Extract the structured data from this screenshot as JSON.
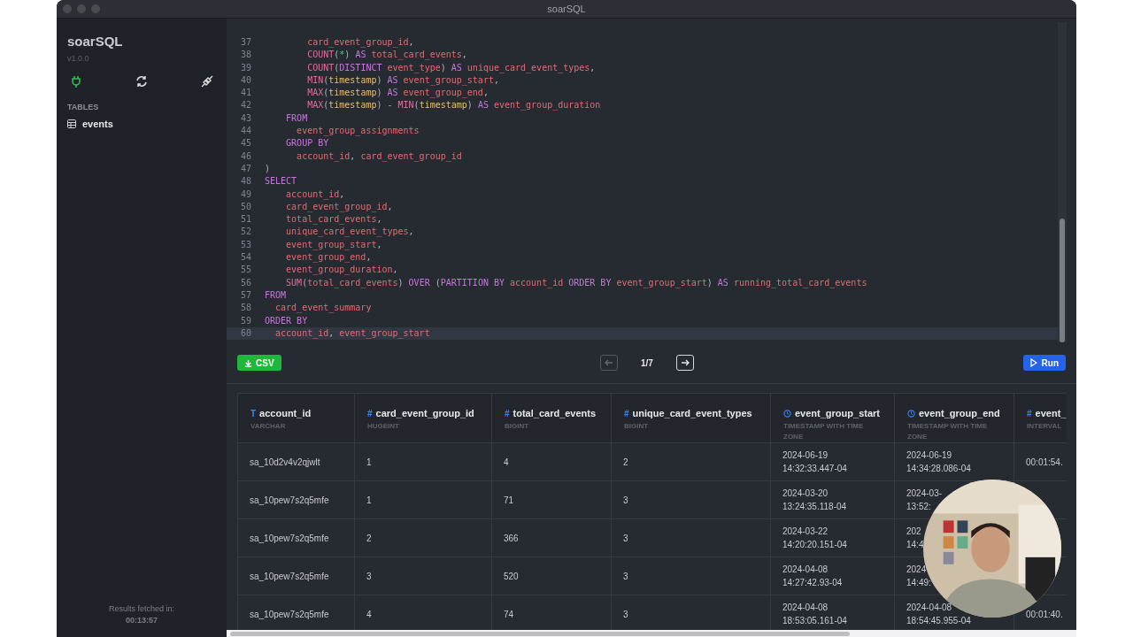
{
  "window": {
    "title": "soarSQL"
  },
  "sidebar": {
    "app_name": "soarSQL",
    "version": "v1.0.0",
    "connected": true,
    "section_label": "TABLES",
    "tables": [
      {
        "name": "events",
        "selected": false
      }
    ],
    "footer_label": "Results fetched in:",
    "footer_time": "00:13:57"
  },
  "editor": {
    "lines": [
      {
        "n": "37",
        "current": false,
        "tokens": [
          {
            "text": "        card_event_group_id",
            "kind": "id"
          },
          {
            "text": ",",
            "kind": "p"
          }
        ]
      },
      {
        "n": "38",
        "current": false,
        "tokens": [
          {
            "text": "        COUNT",
            "kind": "fn"
          },
          {
            "text": "(",
            "kind": "p"
          },
          {
            "text": "*",
            "kind": "op"
          },
          {
            "text": ")",
            "kind": "p"
          },
          {
            "text": " AS ",
            "kind": "kw"
          },
          {
            "text": "total_card_events",
            "kind": "id"
          },
          {
            "text": ",",
            "kind": "p"
          }
        ]
      },
      {
        "n": "39",
        "current": false,
        "tokens": [
          {
            "text": "        COUNT",
            "kind": "fn"
          },
          {
            "text": "(",
            "kind": "p"
          },
          {
            "text": "DISTINCT",
            "kind": "kw"
          },
          {
            "text": " event_type",
            "kind": "id"
          },
          {
            "text": ")",
            "kind": "p"
          },
          {
            "text": " AS ",
            "kind": "kw"
          },
          {
            "text": "unique_card_event_types",
            "kind": "id"
          },
          {
            "text": ",",
            "kind": "p"
          }
        ]
      },
      {
        "n": "40",
        "current": false,
        "tokens": [
          {
            "text": "        MIN",
            "kind": "fn"
          },
          {
            "text": "(",
            "kind": "p"
          },
          {
            "text": "timestamp",
            "kind": "arg"
          },
          {
            "text": ")",
            "kind": "p"
          },
          {
            "text": " AS ",
            "kind": "kw"
          },
          {
            "text": "event_group_start",
            "kind": "id"
          },
          {
            "text": ",",
            "kind": "p"
          }
        ]
      },
      {
        "n": "41",
        "current": false,
        "tokens": [
          {
            "text": "        MAX",
            "kind": "fn"
          },
          {
            "text": "(",
            "kind": "p"
          },
          {
            "text": "timestamp",
            "kind": "arg"
          },
          {
            "text": ")",
            "kind": "p"
          },
          {
            "text": " AS ",
            "kind": "kw"
          },
          {
            "text": "event_group_end",
            "kind": "id"
          },
          {
            "text": ",",
            "kind": "p"
          }
        ]
      },
      {
        "n": "42",
        "current": false,
        "tokens": [
          {
            "text": "        MAX",
            "kind": "fn"
          },
          {
            "text": "(",
            "kind": "p"
          },
          {
            "text": "timestamp",
            "kind": "arg"
          },
          {
            "text": ")",
            "kind": "p"
          },
          {
            "text": " - ",
            "kind": "p"
          },
          {
            "text": "MIN",
            "kind": "fn"
          },
          {
            "text": "(",
            "kind": "p"
          },
          {
            "text": "timestamp",
            "kind": "arg"
          },
          {
            "text": ")",
            "kind": "p"
          },
          {
            "text": " AS ",
            "kind": "kw"
          },
          {
            "text": "event_group_duration",
            "kind": "id"
          }
        ]
      },
      {
        "n": "43",
        "current": false,
        "tokens": [
          {
            "text": "    FROM",
            "kind": "kw"
          }
        ]
      },
      {
        "n": "44",
        "current": false,
        "tokens": [
          {
            "text": "      event_group_assignments",
            "kind": "id"
          }
        ]
      },
      {
        "n": "45",
        "current": false,
        "tokens": [
          {
            "text": "    GROUP BY",
            "kind": "kw"
          }
        ]
      },
      {
        "n": "46",
        "current": false,
        "tokens": [
          {
            "text": "      account_id",
            "kind": "id"
          },
          {
            "text": ", ",
            "kind": "p"
          },
          {
            "text": "card_event_group_id",
            "kind": "id"
          }
        ]
      },
      {
        "n": "47",
        "current": false,
        "tokens": [
          {
            "text": ")",
            "kind": "p"
          }
        ]
      },
      {
        "n": "48",
        "current": false,
        "tokens": [
          {
            "text": "SELECT",
            "kind": "kw"
          }
        ]
      },
      {
        "n": "49",
        "current": false,
        "tokens": [
          {
            "text": "    account_id",
            "kind": "id"
          },
          {
            "text": ",",
            "kind": "p"
          }
        ]
      },
      {
        "n": "50",
        "current": false,
        "tokens": [
          {
            "text": "    card_event_group_id",
            "kind": "id"
          },
          {
            "text": ",",
            "kind": "p"
          }
        ]
      },
      {
        "n": "51",
        "current": false,
        "tokens": [
          {
            "text": "    total_card_events",
            "kind": "id"
          },
          {
            "text": ",",
            "kind": "p"
          }
        ]
      },
      {
        "n": "52",
        "current": false,
        "tokens": [
          {
            "text": "    unique_card_event_types",
            "kind": "id"
          },
          {
            "text": ",",
            "kind": "p"
          }
        ]
      },
      {
        "n": "53",
        "current": false,
        "tokens": [
          {
            "text": "    event_group_start",
            "kind": "id"
          },
          {
            "text": ",",
            "kind": "p"
          }
        ]
      },
      {
        "n": "54",
        "current": false,
        "tokens": [
          {
            "text": "    event_group_end",
            "kind": "id"
          },
          {
            "text": ",",
            "kind": "p"
          }
        ]
      },
      {
        "n": "55",
        "current": false,
        "tokens": [
          {
            "text": "    event_group_duration",
            "kind": "id"
          },
          {
            "text": ",",
            "kind": "p"
          }
        ]
      },
      {
        "n": "56",
        "current": false,
        "tokens": [
          {
            "text": "    SUM",
            "kind": "fn"
          },
          {
            "text": "(",
            "kind": "p"
          },
          {
            "text": "total_card_events",
            "kind": "id"
          },
          {
            "text": ")",
            "kind": "p"
          },
          {
            "text": " OVER ",
            "kind": "kw"
          },
          {
            "text": "(",
            "kind": "p"
          },
          {
            "text": "PARTITION BY",
            "kind": "kw"
          },
          {
            "text": " account_id ",
            "kind": "id"
          },
          {
            "text": "ORDER BY",
            "kind": "kw"
          },
          {
            "text": " event_group_start",
            "kind": "id"
          },
          {
            "text": ")",
            "kind": "p"
          },
          {
            "text": " AS ",
            "kind": "kw"
          },
          {
            "text": "running_total_card_events",
            "kind": "id"
          }
        ]
      },
      {
        "n": "57",
        "current": false,
        "tokens": [
          {
            "text": "FROM",
            "kind": "kw"
          }
        ]
      },
      {
        "n": "58",
        "current": false,
        "tokens": [
          {
            "text": "  card_event_summary",
            "kind": "id"
          }
        ]
      },
      {
        "n": "59",
        "current": false,
        "tokens": [
          {
            "text": "ORDER BY",
            "kind": "kw"
          }
        ]
      },
      {
        "n": "60",
        "current": true,
        "tokens": [
          {
            "text": "  account_id",
            "kind": "id"
          },
          {
            "text": ", ",
            "kind": "p"
          },
          {
            "text": "event_group_start",
            "kind": "id"
          }
        ]
      }
    ]
  },
  "toolbar": {
    "export_label": "CSV",
    "page": "1/7",
    "prev_disabled": true,
    "next_disabled": false,
    "run_label": "Run"
  },
  "results": {
    "columns": [
      {
        "kind": "text",
        "glyph": "T",
        "name": "account_id",
        "type": "VARCHAR"
      },
      {
        "kind": "number",
        "glyph": "#",
        "name": "card_event_group_id",
        "type": "HUGEINT"
      },
      {
        "kind": "number",
        "glyph": "#",
        "name": "total_card_events",
        "type": "BIGINT"
      },
      {
        "kind": "number",
        "glyph": "#",
        "name": "unique_card_event_types",
        "type": "BIGINT"
      },
      {
        "kind": "time",
        "name": "event_group_start",
        "type": "TIMESTAMP WITH TIME ZONE"
      },
      {
        "kind": "time",
        "name": "event_group_end",
        "type": "TIMESTAMP WITH TIME ZONE"
      },
      {
        "kind": "number",
        "glyph": "#",
        "name": "event_",
        "type": "INTERVAL"
      }
    ],
    "rows": [
      {
        "cells": [
          "sa_10d2v4v2qjwlt",
          "1",
          "4",
          "2",
          "2024-06-19\n14:32:33.447-04",
          "2024-06-19\n14:34:28.086-04",
          "00:01:54."
        ]
      },
      {
        "cells": [
          "sa_10pew7s2q5mfe",
          "1",
          "71",
          "3",
          "2024-03-20\n13:24:35.118-04",
          "2024-03-\n13:52:"
        ]
      },
      {
        "cells": [
          "sa_10pew7s2q5mfe",
          "2",
          "366",
          "3",
          "2024-03-22\n14:20:20.151-04",
          "202\n14:4"
        ]
      },
      {
        "cells": [
          "sa_10pew7s2q5mfe",
          "3",
          "520",
          "3",
          "2024-04-08\n14:27:42.93-04",
          "2024\n14:49:"
        ]
      },
      {
        "cells": [
          "sa_10pew7s2q5mfe",
          "4",
          "74",
          "3",
          "2024-04-08\n18:53:05.161-04",
          "2024-04-08\n18:54:45.955-04",
          "00:01:40."
        ]
      }
    ]
  }
}
